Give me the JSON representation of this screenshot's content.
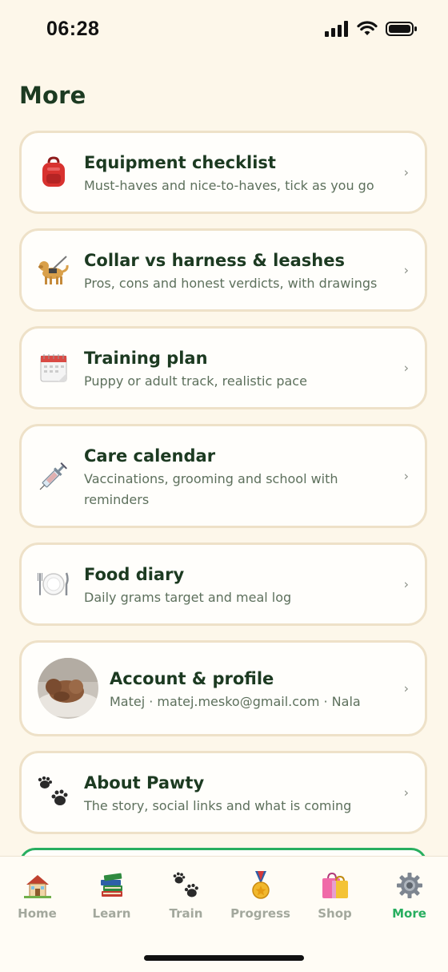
{
  "status_bar": {
    "time": "06:28"
  },
  "page_title": "More",
  "menu_items": [
    {
      "id": "equipment",
      "title": "Equipment checklist",
      "subtitle": "Must-haves and nice-to-haves, tick as you go",
      "icon": "backpack-icon"
    },
    {
      "id": "collar",
      "title": "Collar vs harness & leashes",
      "subtitle": "Pros, cons and honest verdicts, with drawings",
      "icon": "guide-dog-icon"
    },
    {
      "id": "training",
      "title": "Training plan",
      "subtitle": "Puppy or adult track, realistic pace",
      "icon": "calendar-icon"
    },
    {
      "id": "care",
      "title": "Care calendar",
      "subtitle": "Vaccinations, grooming and school with reminders",
      "icon": "syringe-icon"
    },
    {
      "id": "food",
      "title": "Food diary",
      "subtitle": "Daily grams target and meal log",
      "icon": "plate-cutlery-icon"
    },
    {
      "id": "account",
      "title": "Account & profile",
      "subtitle": "Matej · matej.mesko@gmail.com · Nala",
      "icon": "avatar-dog-photo"
    },
    {
      "id": "about",
      "title": "About Pawty",
      "subtitle": "The story, social links and what is coming",
      "icon": "paw-prints-icon"
    }
  ],
  "tab_bar": [
    {
      "label": "Home",
      "icon": "house-icon",
      "active": false
    },
    {
      "label": "Learn",
      "icon": "books-icon",
      "active": false
    },
    {
      "label": "Train",
      "icon": "paw-prints-icon",
      "active": false
    },
    {
      "label": "Progress",
      "icon": "medal-icon",
      "active": false
    },
    {
      "label": "Shop",
      "icon": "shopping-bags-icon",
      "active": false
    },
    {
      "label": "More",
      "icon": "gear-icon",
      "active": true
    }
  ],
  "colors": {
    "background": "#fdf7ea",
    "card_border": "#eee1c8",
    "title": "#1c3a21",
    "subtitle": "#5d705c",
    "accent_green": "#27ae5f",
    "tab_inactive": "#a3a89d"
  }
}
